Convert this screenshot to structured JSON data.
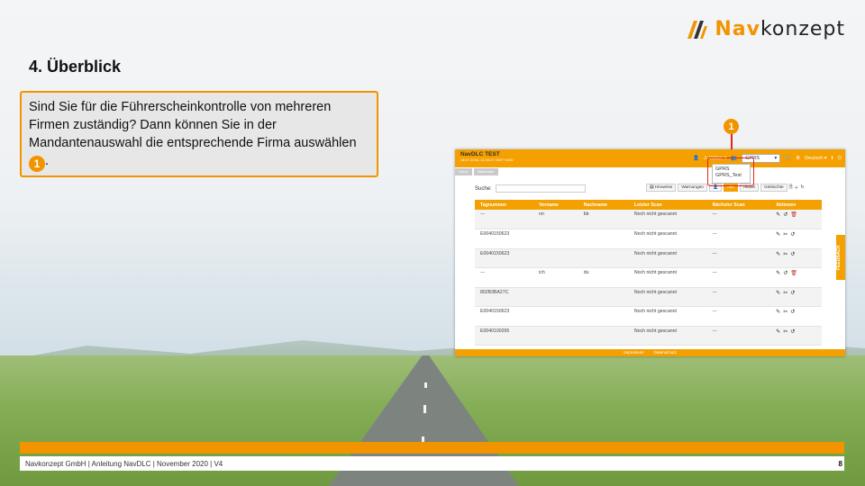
{
  "brand": {
    "logo_nav": "Nav",
    "logo_konzept": "konzept",
    "accent": "#f29400"
  },
  "slide": {
    "title": "4. Überblick",
    "callout_text": "Sind Sie für die Führerscheinkontrolle von mehreren Firmen zuständig? Dann können Sie in der Mandantenauswahl die entsprechende Firma auswählen",
    "callout_badge": "1",
    "callout_tail": "."
  },
  "app": {
    "name": "NavDLC TEST",
    "datetime": "16.07.2018, 11:00:27 GMT+0200",
    "user_menu": "J. Volker ▾",
    "tenant_select": "GPRS",
    "tenant_options": [
      "GPRS",
      "GPRS_Test"
    ],
    "language": "Deutsch ▾",
    "breadcrumb": [
      "Home",
      "Mitarbeiter"
    ],
    "search_label": "Suche:",
    "filters": [
      "Hinweise",
      "Warnungen",
      "Alle",
      "Aktive",
      "Gelöschte"
    ],
    "columns": [
      "Tagnummer",
      "Vorname",
      "Nachname",
      "Letzter Scan",
      "Nächster Scan",
      "Aktionen"
    ],
    "rows": [
      [
        "---",
        "nn",
        "bb",
        "Noch nicht gescannt",
        "---"
      ],
      [
        "E0040150623",
        "",
        "",
        "Noch nicht gescannt",
        "---"
      ],
      [
        "E0040150623",
        "",
        "",
        "Noch nicht gescannt",
        "---"
      ],
      [
        "---",
        "ich",
        "du",
        "Noch nicht gescannt",
        "---"
      ],
      [
        "802B3BA27C",
        "",
        "",
        "Noch nicht gescannt",
        "---"
      ],
      [
        "E0040150623",
        "",
        "",
        "Noch nicht gescannt",
        "---"
      ],
      [
        "E0040100265",
        "",
        "",
        "Noch nicht gescannt",
        "---"
      ]
    ],
    "footer_links": [
      "Impressum",
      "Datenschutz"
    ],
    "feedback": "FEEDBACK",
    "annotation_badge": "1"
  },
  "footer": {
    "text": "Navkonzept GmbH  |  Anleitung NavDLC  |  November 2020  |  V4",
    "page": "8"
  }
}
